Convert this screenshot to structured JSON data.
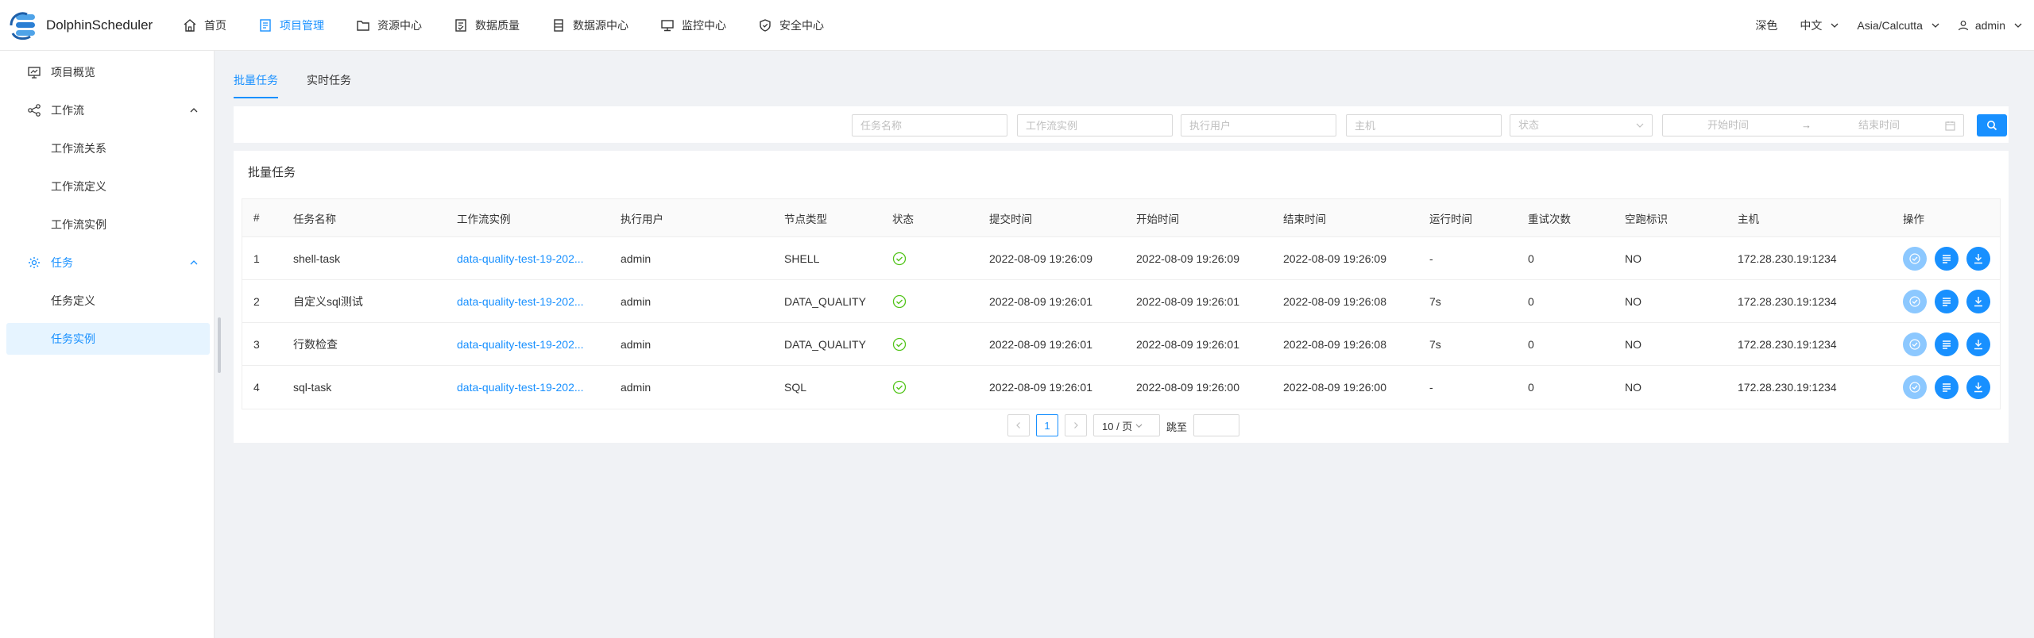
{
  "brand": {
    "name": "DolphinScheduler"
  },
  "nav": {
    "items": [
      {
        "label": "首页",
        "icon": "home-icon",
        "active": false
      },
      {
        "label": "项目管理",
        "icon": "project-icon",
        "active": true
      },
      {
        "label": "资源中心",
        "icon": "folder-icon",
        "active": false
      },
      {
        "label": "数据质量",
        "icon": "data-quality-icon",
        "active": false
      },
      {
        "label": "数据源中心",
        "icon": "datasource-icon",
        "active": false
      },
      {
        "label": "监控中心",
        "icon": "monitor-icon",
        "active": false
      },
      {
        "label": "安全中心",
        "icon": "shield-icon",
        "active": false
      }
    ],
    "theme": "深色",
    "language": "中文",
    "timezone": "Asia/Calcutta",
    "user": "admin"
  },
  "sidebar": {
    "overview": "项目概览",
    "workflow": "工作流",
    "workflow_relation": "工作流关系",
    "workflow_definition": "工作流定义",
    "workflow_instance": "工作流实例",
    "task": "任务",
    "task_definition": "任务定义",
    "task_instance": "任务实例"
  },
  "tabs": [
    "批量任务",
    "实时任务"
  ],
  "filters": {
    "task_name": "任务名称",
    "workflow_instance": "工作流实例",
    "executor": "执行用户",
    "host": "主机",
    "state": "状态",
    "start_time": "开始时间",
    "arrow": "→",
    "end_time": "结束时间"
  },
  "card": {
    "title": "批量任务"
  },
  "table": {
    "headers": [
      "#",
      "任务名称",
      "工作流实例",
      "执行用户",
      "节点类型",
      "状态",
      "提交时间",
      "开始时间",
      "结束时间",
      "运行时间",
      "重试次数",
      "空跑标识",
      "主机",
      "操作"
    ],
    "rows": [
      {
        "idx": "1",
        "name": "shell-task",
        "instance": "data-quality-test-19-202...",
        "user": "admin",
        "type": "SHELL",
        "submit": "2022-08-09 19:26:09",
        "start": "2022-08-09 19:26:09",
        "end": "2022-08-09 19:26:09",
        "duration": "-",
        "retry": "0",
        "dry": "NO",
        "host": "172.28.230.19:1234"
      },
      {
        "idx": "2",
        "name": "自定义sql测试",
        "instance": "data-quality-test-19-202...",
        "user": "admin",
        "type": "DATA_QUALITY",
        "submit": "2022-08-09 19:26:01",
        "start": "2022-08-09 19:26:01",
        "end": "2022-08-09 19:26:08",
        "duration": "7s",
        "retry": "0",
        "dry": "NO",
        "host": "172.28.230.19:1234"
      },
      {
        "idx": "3",
        "name": "行数检查",
        "instance": "data-quality-test-19-202...",
        "user": "admin",
        "type": "DATA_QUALITY",
        "submit": "2022-08-09 19:26:01",
        "start": "2022-08-09 19:26:01",
        "end": "2022-08-09 19:26:08",
        "duration": "7s",
        "retry": "0",
        "dry": "NO",
        "host": "172.28.230.19:1234"
      },
      {
        "idx": "4",
        "name": "sql-task",
        "instance": "data-quality-test-19-202...",
        "user": "admin",
        "type": "SQL",
        "submit": "2022-08-09 19:26:01",
        "start": "2022-08-09 19:26:00",
        "end": "2022-08-09 19:26:00",
        "duration": "-",
        "retry": "0",
        "dry": "NO",
        "host": "172.28.230.19:1234"
      }
    ]
  },
  "pagination": {
    "current": "1",
    "page_size": "10 / 页",
    "jump_label": "跳至"
  },
  "colors": {
    "accent": "#1890ff",
    "success": "#52c41a"
  }
}
